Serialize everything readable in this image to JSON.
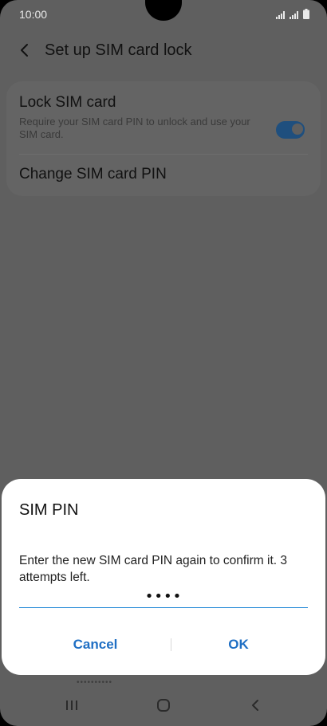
{
  "status_bar": {
    "time": "10:00",
    "icons": [
      "wifi-calling-icon",
      "signal-icon",
      "battery-icon"
    ]
  },
  "app_bar": {
    "title": "Set up SIM card lock",
    "back_icon": "chevron-left-icon"
  },
  "settings": {
    "lock_sim": {
      "title": "Lock SIM card",
      "subtitle": "Require your SIM card PIN to unlock and use your SIM card.",
      "enabled": true
    },
    "change_pin": {
      "title": "Change SIM card PIN"
    }
  },
  "dialog": {
    "title": "SIM PIN",
    "message": "Enter the new SIM card PIN again to confirm it. 3 attempts left.",
    "pin_value": "••••",
    "cancel_label": "Cancel",
    "ok_label": "OK"
  },
  "behind_dialog_hint": "••••••••••",
  "nav_bar": {
    "icons": [
      "recents-icon",
      "home-icon",
      "back-icon"
    ]
  },
  "colors": {
    "accent": "#1f6fc4",
    "input_underline": "#1f86d6",
    "toggle_on": "#1f4f7e",
    "scrim_background": "#5f5f5f"
  }
}
